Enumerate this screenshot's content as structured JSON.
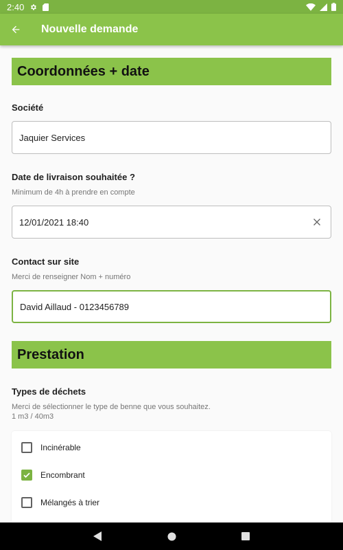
{
  "status_bar": {
    "time": "2:40",
    "icons": [
      "settings-icon",
      "sim-card-icon",
      "wifi-icon",
      "signal-icon",
      "battery-icon"
    ]
  },
  "app_bar": {
    "title": "Nouvelle demande",
    "back_icon": "arrow-back-icon"
  },
  "colors": {
    "primary": "#8bc34a",
    "primary_dark": "#7cb342",
    "focus_border": "#7cb342"
  },
  "sections": {
    "coordonnees": {
      "title": "Coordonnées + date",
      "societe": {
        "label": "Société",
        "value": "Jaquier Services"
      },
      "date_livraison": {
        "label": "Date de livraison souhaitée ?",
        "hint": "Minimum de 4h à prendre en compte",
        "value": "12/01/2021 18:40"
      },
      "contact": {
        "label": "Contact sur site",
        "hint": "Merci de renseigner Nom + numéro",
        "value": "David Aillaud - 0123456789"
      }
    },
    "prestation": {
      "title": "Prestation",
      "types_dechets": {
        "label": "Types de déchets",
        "hint_line1": "Merci de sélectionner le type de benne que vous souhaitez.",
        "hint_line2": "1 m3 / 40m3",
        "options": [
          {
            "label": "Incinérable",
            "checked": false
          },
          {
            "label": "Encombrant",
            "checked": true
          },
          {
            "label": "Mélangés à trier",
            "checked": false
          },
          {
            "label": "",
            "checked": false
          }
        ]
      }
    }
  },
  "nav_bar": {
    "buttons": [
      "back-triangle-icon",
      "home-circle-icon",
      "recents-square-icon"
    ]
  }
}
